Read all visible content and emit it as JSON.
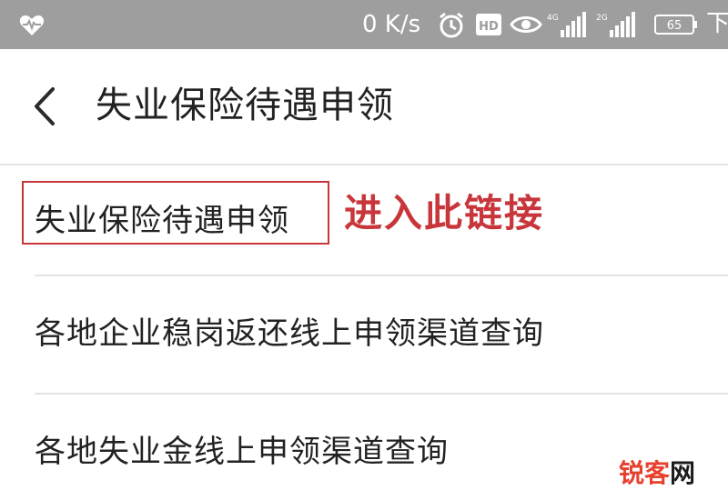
{
  "status_bar": {
    "network_speed": "0 K/s",
    "signal_4g_label": "4G",
    "signal_2g_label": "2G",
    "battery_level": "65",
    "trailing_text": "下",
    "icons": [
      "heart-rate-icon",
      "alarm-icon",
      "hd-icon",
      "eye-icon",
      "signal-4g-icon",
      "signal-2g-icon",
      "battery-icon"
    ]
  },
  "header": {
    "title": "失业保险待遇申领",
    "back_icon": "chevron-left-icon"
  },
  "list": {
    "items": [
      {
        "label": "失业保险待遇申领"
      },
      {
        "label": "各地企业稳岗返还线上申领渠道查询"
      },
      {
        "label": "各地失业金线上申领渠道查询"
      }
    ]
  },
  "annotation": {
    "text": "进入此链接",
    "color": "#c8353a"
  },
  "watermark": {
    "text_part_1": "锐客",
    "text_part_2": "网"
  },
  "colors": {
    "status_bar_bg": "#9e9e9e",
    "text_primary": "#222222",
    "divider": "#e2e2e2",
    "highlight": "#c8353a",
    "watermark": "#e8402e"
  }
}
